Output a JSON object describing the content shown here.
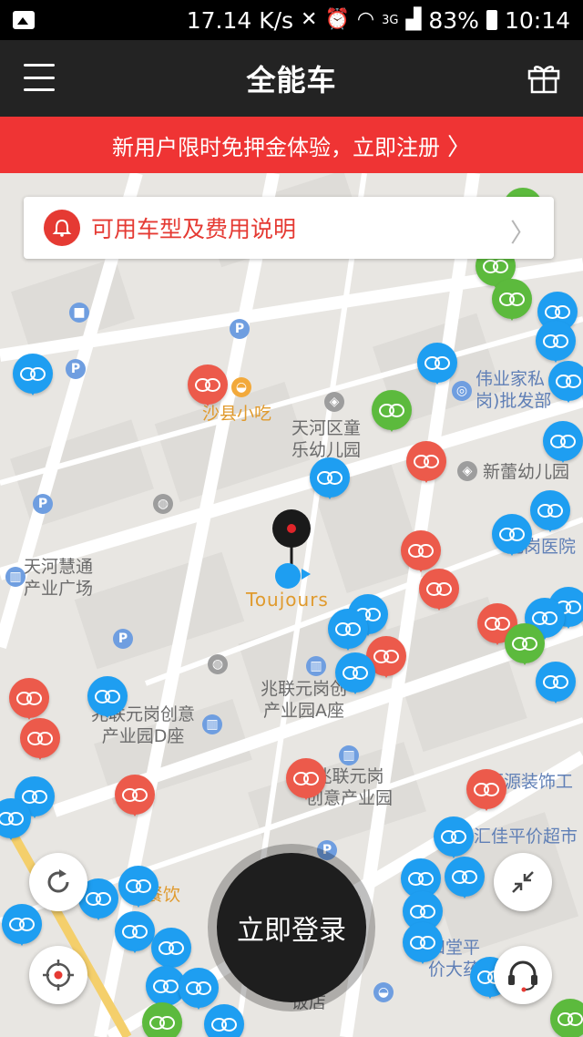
{
  "status_bar": {
    "speed": "17.14 K/s",
    "network": "3G",
    "battery": "83%",
    "time": "10:14"
  },
  "header": {
    "title": "全能车"
  },
  "banner": {
    "text": "新用户限时免押金体验，立即注册"
  },
  "info_card": {
    "label": "可用车型及费用说明"
  },
  "map": {
    "labels": {
      "shaxian": "沙县小吃",
      "kindergarten": "天河区童\n乐幼儿园",
      "weiye": "伟业家私\n岗)批发部",
      "xinlei": "新蕾幼儿园",
      "huitong": "天河慧通\n产业广场",
      "hospital": "元岗医院",
      "zhaolian_a": "兆联元岗创\n产业园A座",
      "zhaolian_d": "兆联元岗创意\n产业园D座",
      "zhaolian_cy": "兆联元岗\n创意产业园",
      "yuanyuan": "原源装饰工",
      "huijia": "汇佳平价超市",
      "hehetang": "和堂平\n价大药",
      "canyin": "餐饮",
      "fandian": "饭店",
      "current_location": "Toujours"
    }
  },
  "buttons": {
    "login": "立即登录"
  }
}
